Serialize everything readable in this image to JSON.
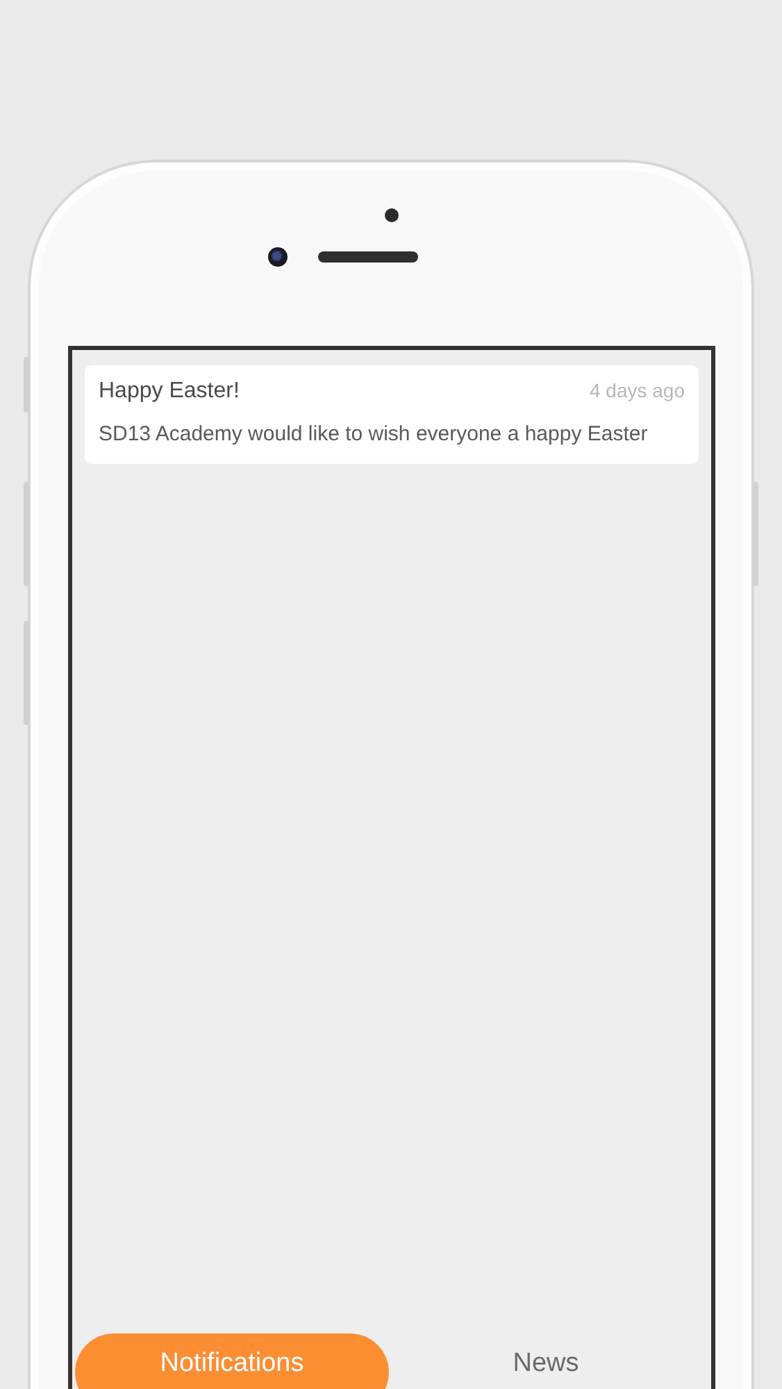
{
  "notifications": [
    {
      "title": "Happy Easter!",
      "time": "4 days ago",
      "body": "SD13 Academy would like to wish everyone a happy Easter"
    }
  ],
  "tabs": [
    {
      "label": "Notifications",
      "selected": true
    },
    {
      "label": "News",
      "selected": false
    }
  ]
}
